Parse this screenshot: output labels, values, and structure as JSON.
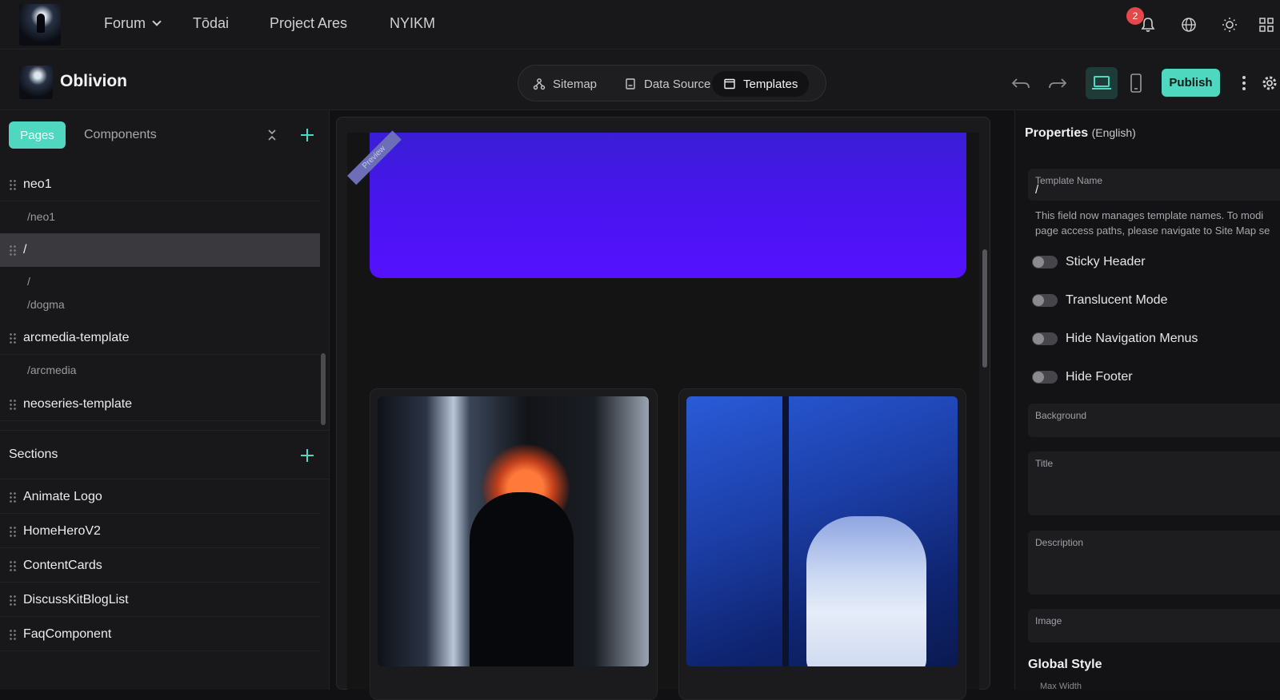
{
  "top_nav": {
    "items": [
      {
        "label": "Forum",
        "has_dropdown": true
      },
      {
        "label": "Tōdai"
      },
      {
        "label": "Project Ares"
      },
      {
        "label": "NYIKM"
      }
    ],
    "notification_count": "2"
  },
  "app": {
    "title": "Oblivion"
  },
  "view_switcher": {
    "tabs": [
      {
        "label": "Sitemap",
        "icon": "sitemap-icon"
      },
      {
        "label": "Data Source",
        "icon": "data-source-icon"
      },
      {
        "label": "Templates",
        "icon": "templates-icon",
        "active": true
      }
    ]
  },
  "toolbar": {
    "publish_label": "Publish",
    "active_device": "desktop"
  },
  "left_panel": {
    "tabs": {
      "pages": "Pages",
      "components": "Components"
    },
    "pages": [
      {
        "name": "neo1",
        "paths": [
          "/neo1"
        ]
      },
      {
        "name": "/",
        "paths": [
          "/",
          "/dogma"
        ],
        "selected": true
      },
      {
        "name": "arcmedia-template",
        "paths": [
          "/arcmedia"
        ]
      },
      {
        "name": "neoseries-template",
        "paths": []
      }
    ],
    "sections_title": "Sections",
    "sections": [
      "Animate Logo",
      "HomeHeroV2",
      "ContentCards",
      "DiscussKitBlogList",
      "FaqComponent"
    ]
  },
  "canvas": {
    "ribbon": "Preview"
  },
  "properties": {
    "title": "Properties",
    "language": "(English)",
    "template_name_label": "Template Name",
    "template_name_value": "/",
    "help_line1": "This field now manages template names. To modi",
    "help_line2": "page access paths, please navigate to Site Map se",
    "toggles": [
      "Sticky Header",
      "Translucent Mode",
      "Hide Navigation Menus",
      "Hide Footer"
    ],
    "background_label": "Background",
    "title_label": "Title",
    "description_label": "Description",
    "image_label": "Image",
    "global_style": "Global Style",
    "max_width_label": "Max Width"
  },
  "colors": {
    "accent": "#4fd7c0",
    "hero": "#4a14f0",
    "badge": "#e54848"
  }
}
